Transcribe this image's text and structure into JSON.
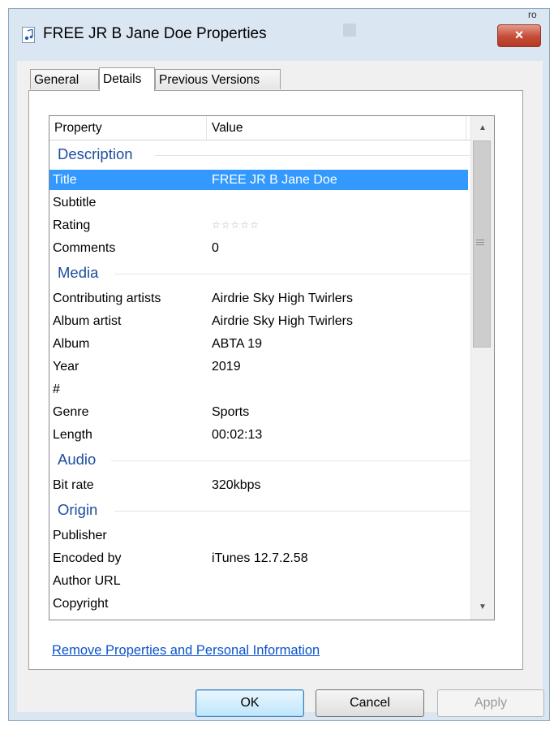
{
  "window": {
    "title": "FREE JR B Jane Doe Properties",
    "close_label": "×",
    "top_glyph": "ro"
  },
  "tabs": [
    {
      "label": "General"
    },
    {
      "label": "Details",
      "active": true
    },
    {
      "label": "Previous Versions"
    }
  ],
  "columns": {
    "property": "Property",
    "value": "Value"
  },
  "groups": {
    "description": {
      "label": "Description",
      "rows": [
        {
          "property": "Title",
          "value": "FREE JR B Jane Doe"
        },
        {
          "property": "Subtitle",
          "value": ""
        },
        {
          "property": "Rating",
          "value": "",
          "rating_stars": 0,
          "rating_max": 5
        },
        {
          "property": "Comments",
          "value": "0"
        }
      ]
    },
    "media": {
      "label": "Media",
      "rows": [
        {
          "property": "Contributing artists",
          "value": "Airdrie Sky High Twirlers"
        },
        {
          "property": "Album artist",
          "value": "Airdrie Sky High Twirlers"
        },
        {
          "property": "Album",
          "value": "ABTA 19"
        },
        {
          "property": "Year",
          "value": "2019"
        },
        {
          "property": "#",
          "value": ""
        },
        {
          "property": "Genre",
          "value": "Sports"
        },
        {
          "property": "Length",
          "value": "00:02:13"
        }
      ]
    },
    "audio": {
      "label": "Audio",
      "rows": [
        {
          "property": "Bit rate",
          "value": "320kbps"
        }
      ]
    },
    "origin": {
      "label": "Origin",
      "rows": [
        {
          "property": "Publisher",
          "value": ""
        },
        {
          "property": "Encoded by",
          "value": "iTunes 12.7.2.58"
        },
        {
          "property": "Author URL",
          "value": ""
        },
        {
          "property": "Copyright",
          "value": ""
        }
      ]
    }
  },
  "link_text": "Remove Properties and Personal Information",
  "buttons": {
    "ok": "OK",
    "cancel": "Cancel",
    "apply": "Apply"
  },
  "colors": {
    "selection": "#3399ff",
    "group_heading": "#1e4ea0",
    "link": "#0a52cc",
    "close": "#c44c37"
  }
}
